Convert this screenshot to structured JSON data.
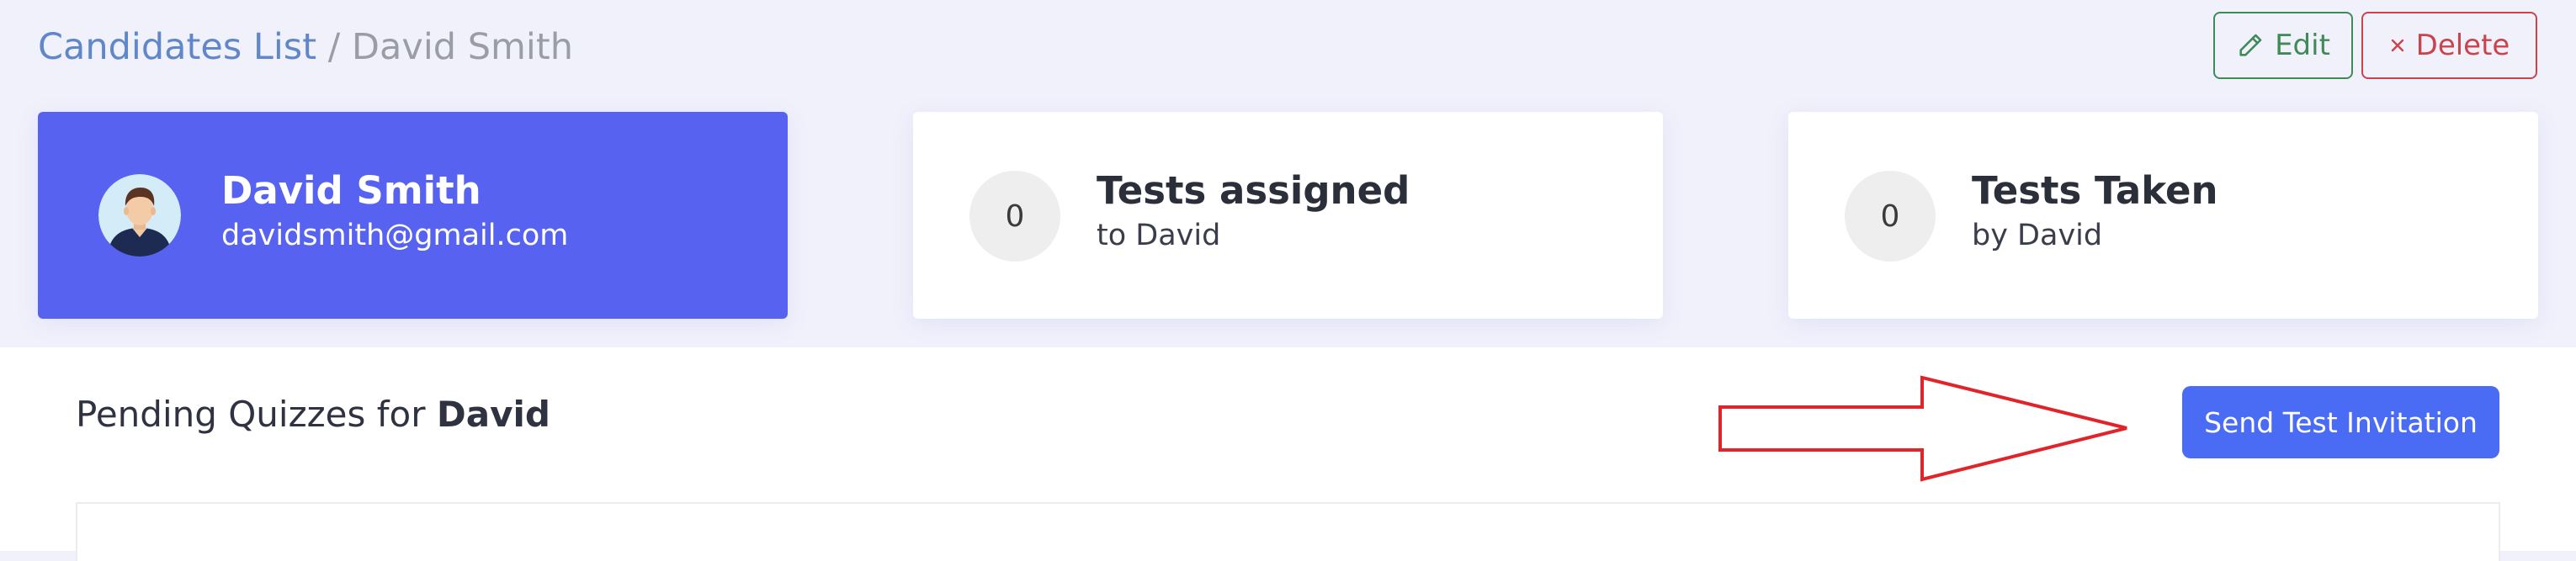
{
  "breadcrumb": {
    "parent": "Candidates List",
    "separator": "/",
    "current": "David Smith"
  },
  "actions": {
    "edit_label": "Edit",
    "delete_label": "Delete"
  },
  "profile": {
    "name": "David Smith",
    "email": "davidsmith@gmail.com"
  },
  "stats": {
    "assigned": {
      "count": "0",
      "title": "Tests assigned",
      "subtitle": "to David"
    },
    "taken": {
      "count": "0",
      "title": "Tests Taken",
      "subtitle": "by David"
    }
  },
  "pending": {
    "heading_prefix": "Pending Quizzes for",
    "heading_name": "David",
    "send_button_label": "Send Test Invitation"
  },
  "icons": {
    "edit": "pencil-icon",
    "delete": "close-icon",
    "avatar": "user-avatar",
    "annotation": "arrow-right-outline"
  },
  "colors": {
    "page_background": "#f1f1fc",
    "profile_card": "#5763f0",
    "primary_button": "#4a6cf5",
    "edit": "#3f8a57",
    "delete": "#c9444c",
    "breadcrumb_link": "#5f87c9",
    "annotation_arrow": "#e0242a"
  }
}
